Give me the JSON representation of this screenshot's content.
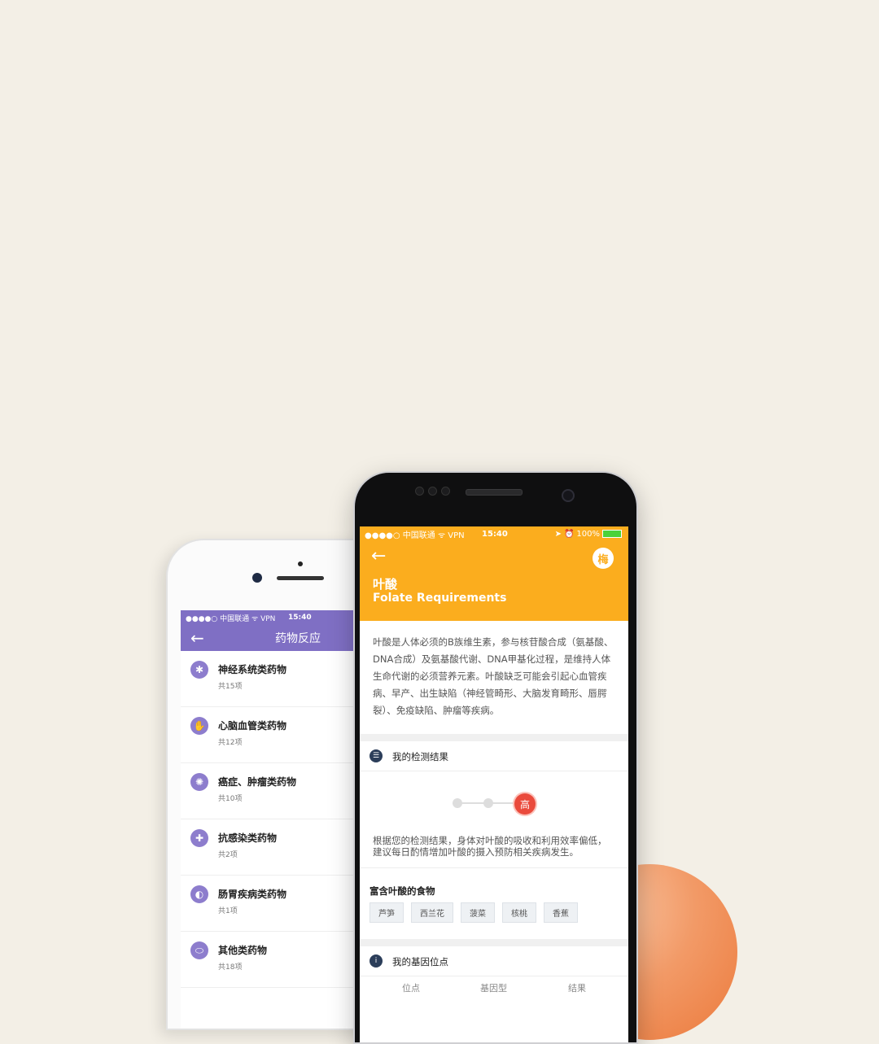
{
  "left_phone": {
    "status": {
      "carrier": "●●●●○ 中国联通 ᯤ VPN",
      "time": "15:40"
    },
    "nav": {
      "back": "←",
      "title": "药物反应"
    },
    "items": [
      {
        "name": "神经系统类药物",
        "count": "共15项",
        "icon": "neuron-icon"
      },
      {
        "name": "心脑血管类药物",
        "count": "共12项",
        "icon": "heart-hand-icon"
      },
      {
        "name": "癌症、肿瘤类药物",
        "count": "共10项",
        "icon": "cell-icon"
      },
      {
        "name": "抗感染类药物",
        "count": "共2项",
        "icon": "shield-icon"
      },
      {
        "name": "肠胃疾病类药物",
        "count": "共1项",
        "icon": "stomach-icon"
      },
      {
        "name": "其他类药物",
        "count": "共18项",
        "icon": "pill-icon"
      }
    ]
  },
  "right_phone": {
    "status": {
      "carrier": "●●●●○ 中国联通 ᯤ VPN",
      "time": "15:40",
      "battery": "100%"
    },
    "back": "←",
    "avatar": "梅",
    "title": "叶酸",
    "subtitle": "Folate Requirements",
    "description": "叶酸是人体必须的B族维生素，参与核苷酸合成（氨基酸、DNA合成）及氨基酸代谢、DNA甲基化过程，是维持人体生命代谢的必须营养元素。叶酸缺乏可能会引起心血管疾病、早产、出生缺陷（神经管畸形、大脑发育畸形、唇腭裂）、免疫缺陷、肿瘤等疾病。",
    "result_section": {
      "title": "我的检测结果",
      "level": "高",
      "level_index": 3,
      "level_count": 3
    },
    "advice": "根据您的检测结果，身体对叶酸的吸收和利用效率偏低，建议每日酌情增加叶酸的摄入预防相关疾病发生。",
    "foods": {
      "title": "富含叶酸的食物",
      "items": [
        "芦笋",
        "西兰花",
        "菠菜",
        "核桃",
        "香蕉"
      ]
    },
    "gene_section": {
      "title": "我的基因位点",
      "columns": [
        "位点",
        "基因型",
        "结果"
      ]
    }
  },
  "colors": {
    "purple": "#7f6fc4",
    "orange": "#fbad1e",
    "red": "#ea4a3c",
    "background": "#f3efe6"
  }
}
